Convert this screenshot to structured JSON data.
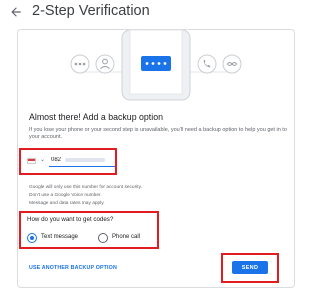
{
  "header": {
    "title": "2-Step Verification",
    "back_icon": "arrow-left-icon"
  },
  "illustration": {
    "icons": [
      "password-icon",
      "person-icon",
      "phone-dots-icon",
      "call-icon",
      "infinity-icon"
    ],
    "accent": "#1a73e8"
  },
  "backup": {
    "heading": "Almost there! Add a backup option",
    "description": "If you lose your phone or your second step is unavailable, you'll need a backup option to help you get in to your account.",
    "phone": {
      "country_flag": "indonesia-flag-icon",
      "value": "082"
    },
    "notes": [
      "Google will only use this number for account security.",
      "Don't use a Google Voice number.",
      "Message and data rates may apply."
    ],
    "codes": {
      "question": "How do you want to get codes?",
      "options": [
        {
          "label": "Text message",
          "selected": true
        },
        {
          "label": "Phone call",
          "selected": false
        }
      ]
    }
  },
  "actions": {
    "alt_option": "USE ANOTHER BACKUP OPTION",
    "send": "SEND"
  },
  "colors": {
    "accent": "#1a73e8",
    "highlight": "#e11d22",
    "border": "#dadce0"
  }
}
